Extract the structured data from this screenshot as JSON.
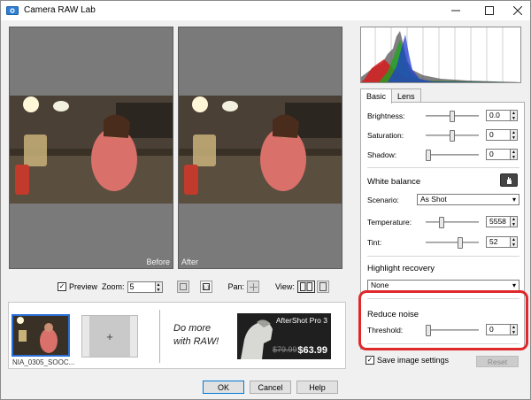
{
  "window": {
    "title": "Camera RAW Lab"
  },
  "preview": {
    "before_label": "Before",
    "after_label": "After"
  },
  "toolbar": {
    "preview_label": "Preview",
    "preview_checked": true,
    "zoom_label": "Zoom:",
    "zoom_value": "5",
    "pan_label": "Pan:",
    "view_label": "View:"
  },
  "strip": {
    "thumbnail_label": "NIA_0305_SOOC...",
    "add_symbol": "+",
    "promo_line1": "Do more",
    "promo_line2": "with RAW!",
    "ad": {
      "title": "AfterShot Pro 3",
      "old_price": "$79.99",
      "new_price": "$63.99"
    }
  },
  "buttons": {
    "ok": "OK",
    "cancel": "Cancel",
    "help": "Help"
  },
  "panel": {
    "tabs": [
      "Basic",
      "Lens"
    ],
    "active_tab": "Basic",
    "brightness": {
      "label": "Brightness:",
      "value": "0.0",
      "level": 0.5
    },
    "saturation": {
      "label": "Saturation:",
      "value": "0",
      "level": 0.5
    },
    "shadow": {
      "label": "Shadow:",
      "value": "0",
      "level": 0.0
    },
    "white_balance": {
      "title": "White balance",
      "scenario_label": "Scenario:",
      "scenario_value": "As Shot",
      "temperature": {
        "label": "Temperature:",
        "value": "5558",
        "level": 0.28
      },
      "tint": {
        "label": "Tint:",
        "value": "52",
        "level": 0.66
      }
    },
    "highlight_recovery": {
      "title": "Highlight recovery",
      "value": "None"
    },
    "reduce_noise": {
      "title": "Reduce noise",
      "threshold": {
        "label": "Threshold:",
        "value": "0",
        "level": 0.0
      }
    },
    "save_settings_label": "Save image settings",
    "save_settings_checked": true,
    "reset_label": "Reset"
  },
  "colors": {
    "accent": "#0078d7",
    "highlight": "#e0282a",
    "preview_bg": "#7a7a7a"
  }
}
